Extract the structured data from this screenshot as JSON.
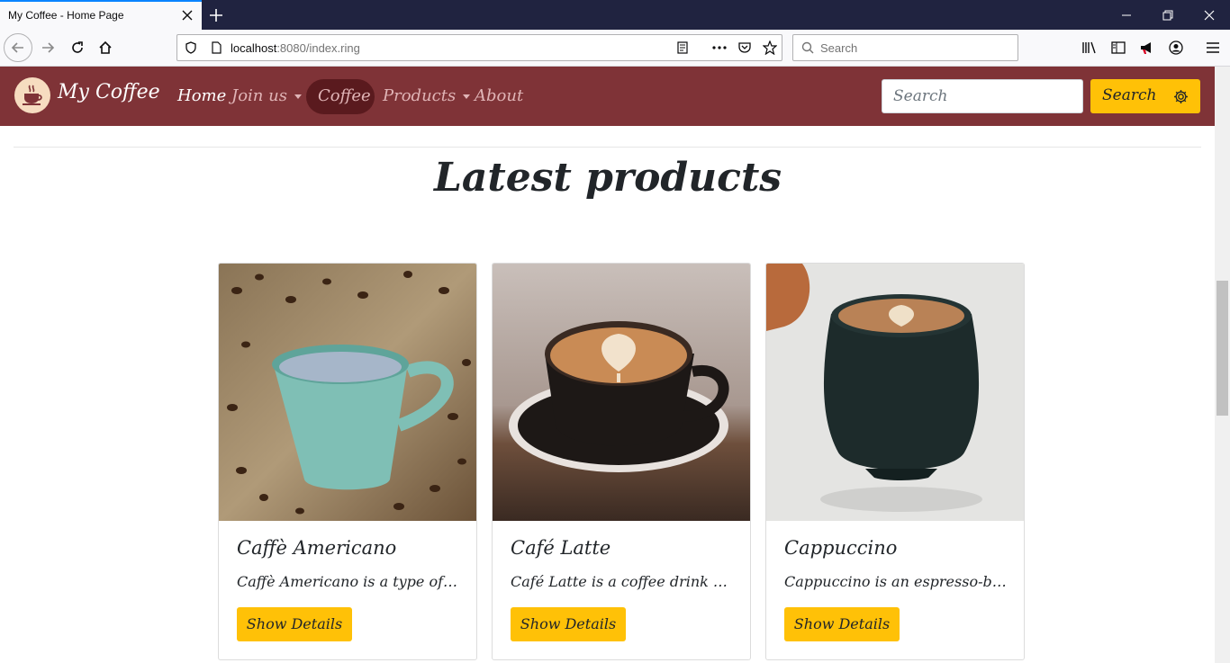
{
  "browser": {
    "tab_title": "My Coffee - Home Page",
    "url_host": "localhost",
    "url_rest": ":8080/index.ring",
    "search_placeholder": "Search"
  },
  "site": {
    "brand": "My Coffee",
    "nav": {
      "home": "Home",
      "join_us": "Join us",
      "coffee": "Coffee",
      "products": "Products",
      "about": "About"
    },
    "search_placeholder": "Search",
    "search_button": "Search"
  },
  "main": {
    "heading": "Latest products",
    "products": [
      {
        "title": "Caffè Americano",
        "text": "Caffè Americano is a type of coffee",
        "button": "Show Details"
      },
      {
        "title": "Café Latte",
        "text": "Café Latte is a coffee drink made",
        "button": "Show Details"
      },
      {
        "title": "Cappuccino",
        "text": "Cappuccino is an espresso-based",
        "button": "Show Details"
      }
    ]
  },
  "colors": {
    "nav_bg": "#7f3337",
    "accent": "#ffc107",
    "active_pill": "#5a1a1e"
  }
}
